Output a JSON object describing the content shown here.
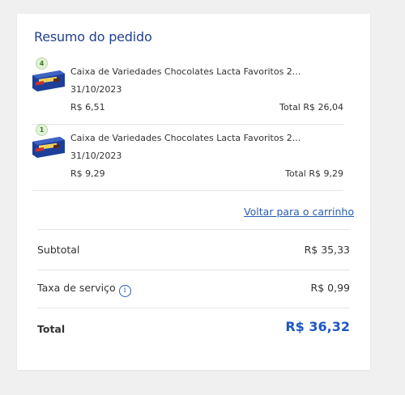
{
  "summary": {
    "title": "Resumo do pedido",
    "items": [
      {
        "quantity": "4",
        "name": "Caixa de Variedades Chocolates Lacta Favoritos 2...",
        "date": "31/10/2023",
        "unit_price": "R$ 6,51",
        "total": "Total R$ 26,04",
        "image": "lacta-box-icon"
      },
      {
        "quantity": "1",
        "name": "Caixa de Variedades Chocolates Lacta Favoritos 2...",
        "date": "31/10/2023",
        "unit_price": "R$ 9,29",
        "total": "Total R$ 9,29",
        "image": "lacta-box-icon"
      }
    ],
    "back_link": "Voltar para o carrinho",
    "subtotal_label": "Subtotal",
    "subtotal_value": "R$ 35,33",
    "service_fee_label": "Taxa de serviço",
    "service_fee_value": "R$ 0,99",
    "total_label": "Total",
    "total_value": "R$ 36,32"
  },
  "colors": {
    "title": "#24408e",
    "link": "#2a5db0",
    "total": "#1f56c2",
    "badge_bg": "#e3f1da"
  }
}
